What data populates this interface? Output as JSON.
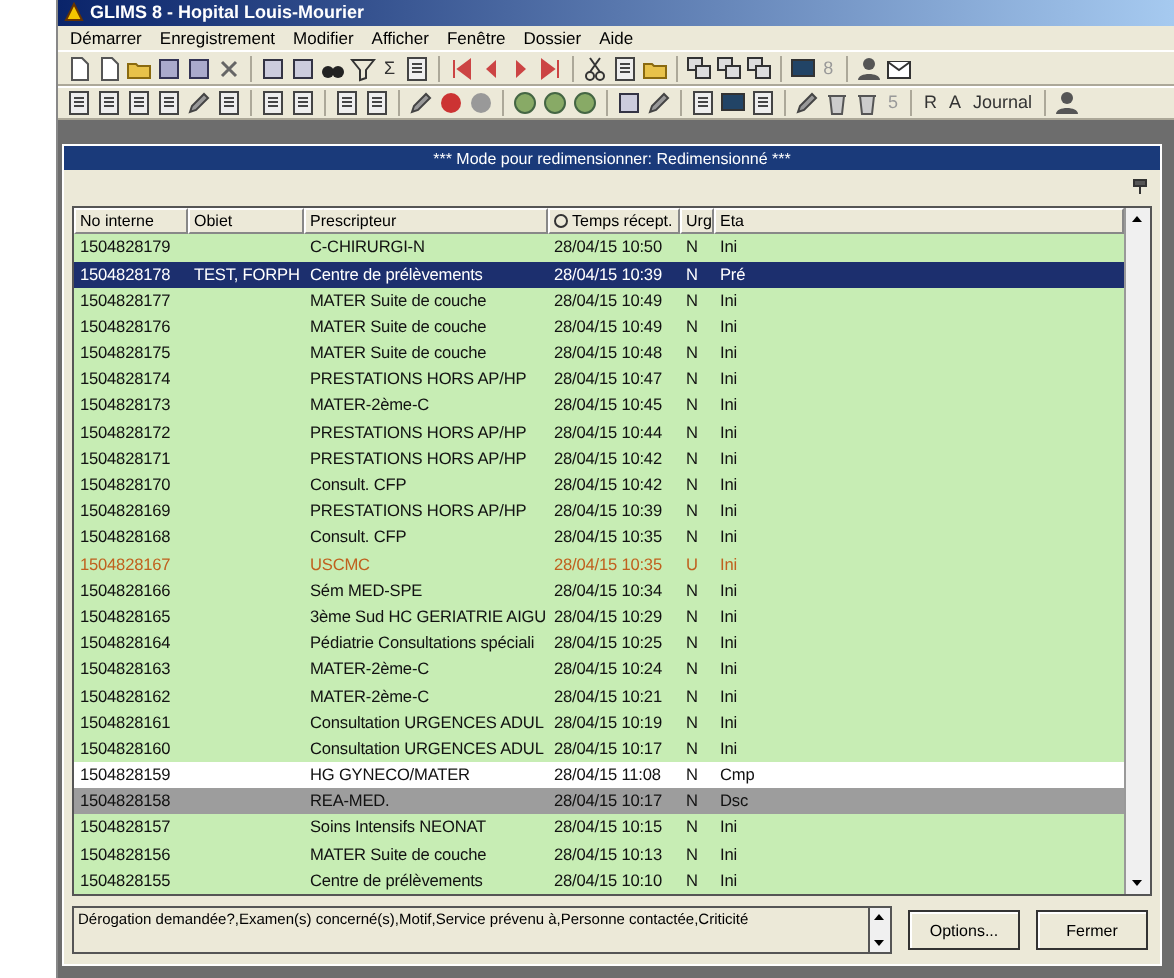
{
  "window": {
    "title": "GLIMS 8 - Hopital Louis-Mourier"
  },
  "menu": [
    "Démarrer",
    "Enregistrement",
    "Modifier",
    "Afficher",
    "Fenêtre",
    "Dossier",
    "Aide"
  ],
  "toolbar_texts": [
    "Σ",
    "8",
    "5",
    "R",
    "A",
    "Journal"
  ],
  "dialog": {
    "title": "*** Mode pour redimensionner: Redimensionné ***"
  },
  "table": {
    "columns": [
      "No interne",
      "Obiet",
      "Prescripteur",
      "Temps récept.",
      "Urg",
      "Eta"
    ],
    "rows": [
      {
        "no": "1504828179",
        "objet": "",
        "prescripteur": "C-CHIRURGI-N",
        "temps": "28/04/15 10:50",
        "urg": "N",
        "eta": "Ini",
        "selected": false,
        "kind": "normal"
      },
      {
        "no": "1504828178",
        "objet": "TEST, FORPH",
        "prescripteur": "Centre de prélèvements",
        "temps": "28/04/15 10:39",
        "urg": "N",
        "eta": "Pré",
        "selected": true,
        "kind": "normal"
      },
      {
        "no": "1504828177",
        "objet": "",
        "prescripteur": "MATER Suite de couche",
        "temps": "28/04/15 10:49",
        "urg": "N",
        "eta": "Ini",
        "selected": false,
        "kind": "normal"
      },
      {
        "no": "1504828176",
        "objet": "",
        "prescripteur": "MATER Suite de couche",
        "temps": "28/04/15 10:49",
        "urg": "N",
        "eta": "Ini",
        "selected": false,
        "kind": "normal"
      },
      {
        "no": "1504828175",
        "objet": "",
        "prescripteur": "MATER Suite de couche",
        "temps": "28/04/15 10:48",
        "urg": "N",
        "eta": "Ini",
        "selected": false,
        "kind": "normal"
      },
      {
        "no": "1504828174",
        "objet": "",
        "prescripteur": "PRESTATIONS HORS AP/HP",
        "temps": "28/04/15 10:47",
        "urg": "N",
        "eta": "Ini",
        "selected": false,
        "kind": "normal"
      },
      {
        "no": "1504828173",
        "objet": "",
        "prescripteur": "MATER-2ème-C",
        "temps": "28/04/15 10:45",
        "urg": "N",
        "eta": "Ini",
        "selected": false,
        "kind": "normal"
      },
      {
        "no": "1504828172",
        "objet": "",
        "prescripteur": "PRESTATIONS HORS AP/HP",
        "temps": "28/04/15 10:44",
        "urg": "N",
        "eta": "Ini",
        "selected": false,
        "kind": "normal"
      },
      {
        "no": "1504828171",
        "objet": "",
        "prescripteur": "PRESTATIONS HORS AP/HP",
        "temps": "28/04/15 10:42",
        "urg": "N",
        "eta": "Ini",
        "selected": false,
        "kind": "normal"
      },
      {
        "no": "1504828170",
        "objet": "",
        "prescripteur": "Consult. CFP",
        "temps": "28/04/15 10:42",
        "urg": "N",
        "eta": "Ini",
        "selected": false,
        "kind": "normal"
      },
      {
        "no": "1504828169",
        "objet": "",
        "prescripteur": "PRESTATIONS HORS AP/HP",
        "temps": "28/04/15 10:39",
        "urg": "N",
        "eta": "Ini",
        "selected": false,
        "kind": "normal"
      },
      {
        "no": "1504828168",
        "objet": "",
        "prescripteur": "Consult. CFP",
        "temps": "28/04/15 10:35",
        "urg": "N",
        "eta": "Ini",
        "selected": false,
        "kind": "normal"
      },
      {
        "no": "1504828167",
        "objet": "",
        "prescripteur": "USCMC",
        "temps": "28/04/15 10:35",
        "urg": "U",
        "eta": "Ini",
        "selected": false,
        "kind": "urgent"
      },
      {
        "no": "1504828166",
        "objet": "",
        "prescripteur": "Sém MED-SPE",
        "temps": "28/04/15 10:34",
        "urg": "N",
        "eta": "Ini",
        "selected": false,
        "kind": "normal"
      },
      {
        "no": "1504828165",
        "objet": "",
        "prescripteur": "3ème Sud HC GERIATRIE AIGU",
        "temps": "28/04/15 10:29",
        "urg": "N",
        "eta": "Ini",
        "selected": false,
        "kind": "normal"
      },
      {
        "no": "1504828164",
        "objet": "",
        "prescripteur": "Pédiatrie Consultations spéciali",
        "temps": "28/04/15 10:25",
        "urg": "N",
        "eta": "Ini",
        "selected": false,
        "kind": "normal"
      },
      {
        "no": "1504828163",
        "objet": "",
        "prescripteur": "MATER-2ème-C",
        "temps": "28/04/15 10:24",
        "urg": "N",
        "eta": "Ini",
        "selected": false,
        "kind": "normal"
      },
      {
        "no": "1504828162",
        "objet": "",
        "prescripteur": "MATER-2ème-C",
        "temps": "28/04/15 10:21",
        "urg": "N",
        "eta": "Ini",
        "selected": false,
        "kind": "normal"
      },
      {
        "no": "1504828161",
        "objet": "",
        "prescripteur": "Consultation URGENCES ADUL",
        "temps": "28/04/15 10:19",
        "urg": "N",
        "eta": "Ini",
        "selected": false,
        "kind": "normal"
      },
      {
        "no": "1504828160",
        "objet": "",
        "prescripteur": "Consultation URGENCES ADUL",
        "temps": "28/04/15 10:17",
        "urg": "N",
        "eta": "Ini",
        "selected": false,
        "kind": "normal"
      },
      {
        "no": "1504828159",
        "objet": "",
        "prescripteur": "HG GYNECO/MATER",
        "temps": "28/04/15 11:08",
        "urg": "N",
        "eta": "Cmp",
        "selected": false,
        "kind": "complete"
      },
      {
        "no": "1504828158",
        "objet": "",
        "prescripteur": "REA-MED.",
        "temps": "28/04/15 10:17",
        "urg": "N",
        "eta": "Dsc",
        "selected": false,
        "kind": "discarded"
      },
      {
        "no": "1504828157",
        "objet": "",
        "prescripteur": "Soins Intensifs NEONAT",
        "temps": "28/04/15 10:15",
        "urg": "N",
        "eta": "Ini",
        "selected": false,
        "kind": "normal"
      },
      {
        "no": "1504828156",
        "objet": "",
        "prescripteur": "MATER Suite de couche",
        "temps": "28/04/15 10:13",
        "urg": "N",
        "eta": "Ini",
        "selected": false,
        "kind": "normal"
      },
      {
        "no": "1504828155",
        "objet": "",
        "prescripteur": "Centre de prélèvements",
        "temps": "28/04/15 10:10",
        "urg": "N",
        "eta": "Ini",
        "selected": false,
        "kind": "normal"
      }
    ]
  },
  "notes": {
    "value": "Dérogation demandée?,Examen(s) concerné(s),Motif,Service prévenu à,Personne contactée,Criticité"
  },
  "buttons": [
    "Options...",
    "Fermer"
  ]
}
